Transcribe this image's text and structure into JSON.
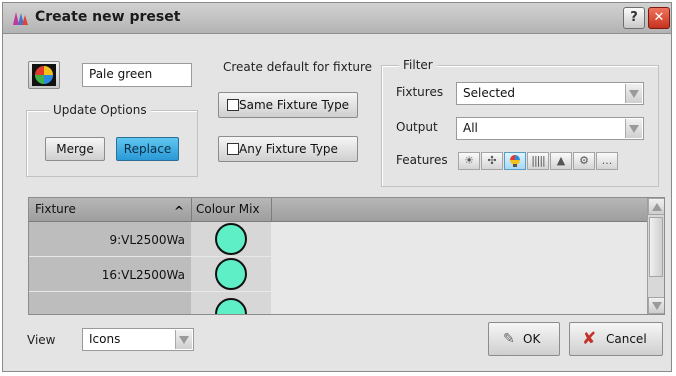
{
  "window": {
    "title": "Create new preset",
    "help_label": "?",
    "close_label": "✕"
  },
  "preset": {
    "name_value": "Pale green"
  },
  "update_options": {
    "legend": "Update Options",
    "merge_label": "Merge",
    "replace_label": "Replace",
    "selected": "Replace"
  },
  "create_default": {
    "legend": "Create default for fixture",
    "same_fixture_type_label": "Same Fixture Type",
    "any_fixture_type_label": "Any Fixture Type"
  },
  "filter": {
    "legend": "Filter",
    "fixtures_label": "Fixtures",
    "fixtures_value": "Selected",
    "output_label": "Output",
    "output_value": "All",
    "features_label": "Features",
    "features": [
      {
        "icon": "dimmer-icon"
      },
      {
        "icon": "position-icon"
      },
      {
        "icon": "colour-icon"
      },
      {
        "icon": "gobo-icon"
      },
      {
        "icon": "beam-icon"
      },
      {
        "icon": "effects-icon"
      },
      {
        "icon": "more-icon",
        "label": "..."
      }
    ]
  },
  "table": {
    "columns": [
      "Fixture",
      "Colour Mix"
    ],
    "sort_indicator": "^",
    "rows": [
      {
        "fixture": "9:VL2500Wa",
        "colour": "#5fefc6"
      },
      {
        "fixture": "16:VL2500Wa",
        "colour": "#5fefc6"
      },
      {
        "fixture": "",
        "colour": "#5fefc6"
      }
    ]
  },
  "view": {
    "label": "View",
    "value": "Icons"
  },
  "actions": {
    "ok_label": "OK",
    "cancel_label": "Cancel"
  },
  "colors": {
    "accent_selected": "#2a99d6",
    "swatch": "#5fefc6",
    "close_red": "#d23b27"
  }
}
